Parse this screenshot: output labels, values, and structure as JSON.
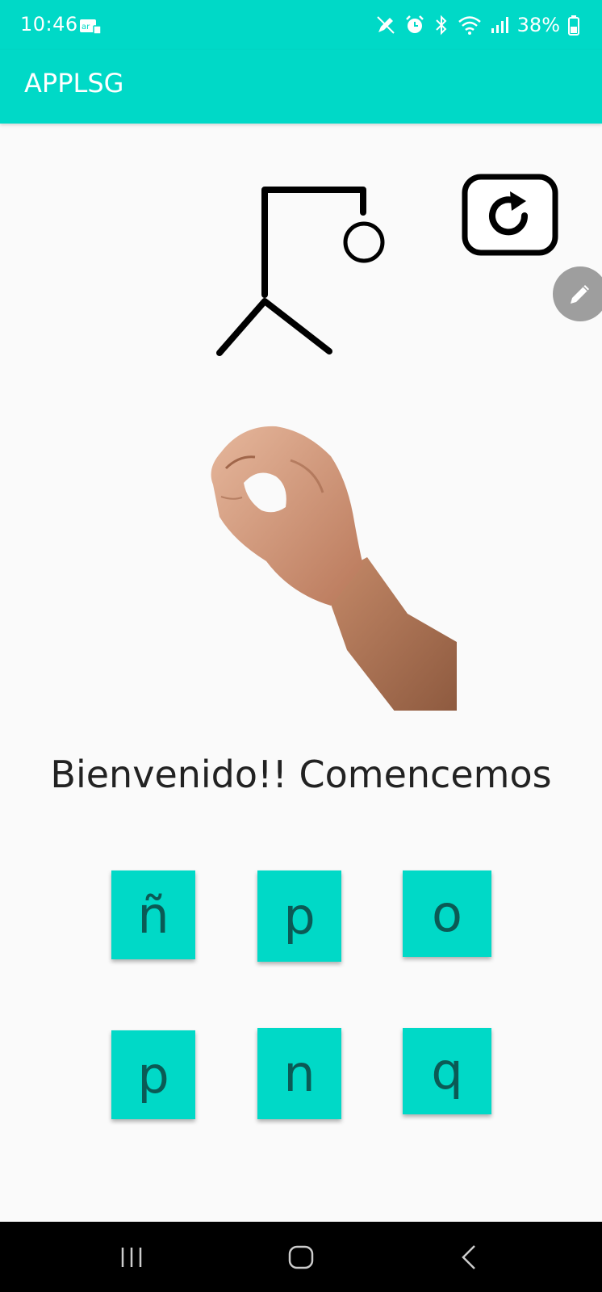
{
  "status_bar": {
    "time": "10:46",
    "battery_percent": "38%"
  },
  "app_bar": {
    "title": "APPLSG"
  },
  "game": {
    "welcome_text": "Bienvenido!! Comencemos",
    "options": [
      "ñ",
      "p",
      "o",
      "p",
      "n",
      "q"
    ]
  },
  "colors": {
    "accent": "#00d9c7",
    "letter_text": "#0b5a55"
  },
  "icons": {
    "refresh": "refresh-icon",
    "edit": "pencil-icon",
    "nav_recents": "recents-icon",
    "nav_home": "home-icon",
    "nav_back": "back-icon"
  }
}
